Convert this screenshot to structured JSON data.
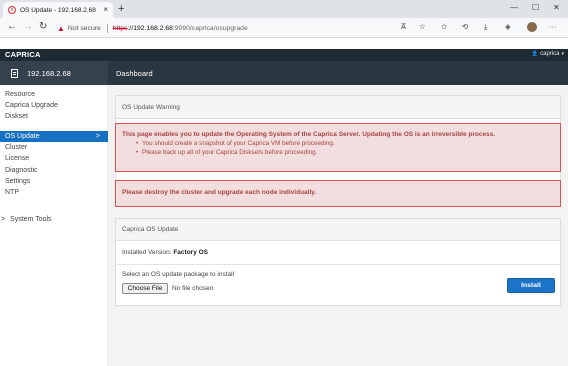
{
  "browser": {
    "tab_title": "OS Update - 192.168.2.68",
    "tab_favicon": "x",
    "tab_close": "×",
    "new_tab": "+",
    "window_controls": {
      "minimize": "—",
      "maximize": "☐",
      "close": "✕"
    },
    "nav": {
      "back": "←",
      "forward": "→",
      "reload": "↻"
    },
    "security_warning_icon": "▲",
    "not_secure": "Not secure",
    "url_scheme": "https",
    "url_host": "://192.168.2.68",
    "url_rest": ":9090/caprica/osupgrade",
    "toolbar_icons": {
      "read_aloud": "A̅",
      "favorites_add": "☆",
      "favorites": "✩",
      "history": "⟲",
      "downloads": "⤓",
      "extensions": "◈",
      "more": "···"
    }
  },
  "app": {
    "brand": "CAPRICA",
    "user": "caprica",
    "user_icon": "👤",
    "host": "192.168.2.68",
    "breadcrumb": "Dashboard"
  },
  "sidebar": {
    "items": [
      {
        "label": "Resource"
      },
      {
        "label": "Caprica Upgrade"
      },
      {
        "label": "Diskset"
      },
      {
        "label": "OS Update",
        "active": true,
        "chevron": ">"
      },
      {
        "label": "Cluster"
      },
      {
        "label": "License"
      },
      {
        "label": "Diagnostic"
      },
      {
        "label": "Settings"
      },
      {
        "label": "NTP"
      },
      {
        "label": "System Tools",
        "prefix": ">"
      }
    ]
  },
  "warning_panel": {
    "heading": "OS Update Warning",
    "alert_text": "This page enables you to update the Operating System of the Caprica Server. Updating the OS is an irreversible process.",
    "bullets": [
      "You should create a snapshot of your Caprica VM before proceeding.",
      "Please back up all of your Caprica Disksets before proceeding."
    ]
  },
  "cluster_alert": "Please destroy the cluster and upgrade each node individually.",
  "update_panel": {
    "heading": "Caprica OS Update",
    "installed_label": "Installed Version:",
    "installed_value": "Factory OS",
    "select_label": "Select an OS update package to install",
    "choose_file_button": "Choose File",
    "no_file_text": "No file chosen",
    "install_button": "Install"
  },
  "colors": {
    "header_bg": "#1e2a33",
    "host_bar_bg": "#35424d",
    "dashboard_bar_bg": "#2b3740",
    "sidebar_active": "#1671c0",
    "alert_bg": "#f2dede",
    "alert_border": "#d9534f",
    "alert_text": "#a94442",
    "install_button": "#1b74c7"
  }
}
